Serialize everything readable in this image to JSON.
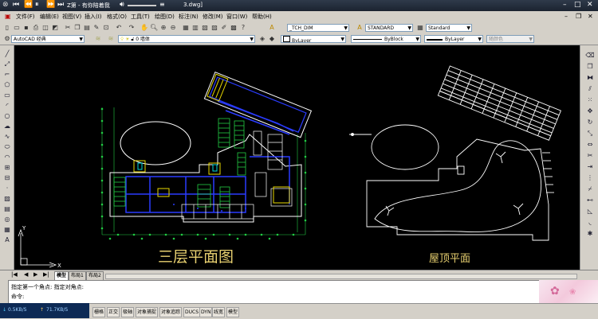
{
  "titlebar": {
    "title_fragment": "Z第 - 有你陪着我",
    "file_fragment": "3.dwg]"
  },
  "menu": {
    "items": [
      "文件(F)",
      "编辑(E)",
      "视图(V)",
      "插入(I)",
      "格式(O)",
      "工具(T)",
      "绘图(D)",
      "标注(N)",
      "修改(M)",
      "窗口(W)",
      "帮助(H)"
    ]
  },
  "toolbar": {
    "dim_style": "_TCH_DIM",
    "text_style": "STANDARD",
    "table_style": "Standard"
  },
  "properties": {
    "workspace": "AutoCAD 经典",
    "layer": "0 墙体",
    "color": "ByLayer",
    "linetype": "ByBlock",
    "lineweight": "ByLayer",
    "plotstyle": "随颜色"
  },
  "drawing": {
    "plan_label": "三层平面图",
    "roof_label": "屋顶平面"
  },
  "layout_tabs": [
    "模型",
    "布局1",
    "布局2"
  ],
  "command": {
    "history": "指定第一个角点: 指定对角点:",
    "prompt": "命令:"
  },
  "status": {
    "net_down": "0.5KB/S",
    "net_up": "71.7KB/S",
    "toggles": [
      "栅格",
      "正交",
      "极轴",
      "对象捕捉",
      "对象追踪",
      "DUCS",
      "DYN",
      "线宽",
      "模型"
    ]
  },
  "colors": {
    "canvas": "#000000",
    "wall": "#ffffff",
    "blue_lines": "#2a3cff",
    "green": "#22cc44",
    "yellow": "#e8d800",
    "label": "#e8d070"
  }
}
